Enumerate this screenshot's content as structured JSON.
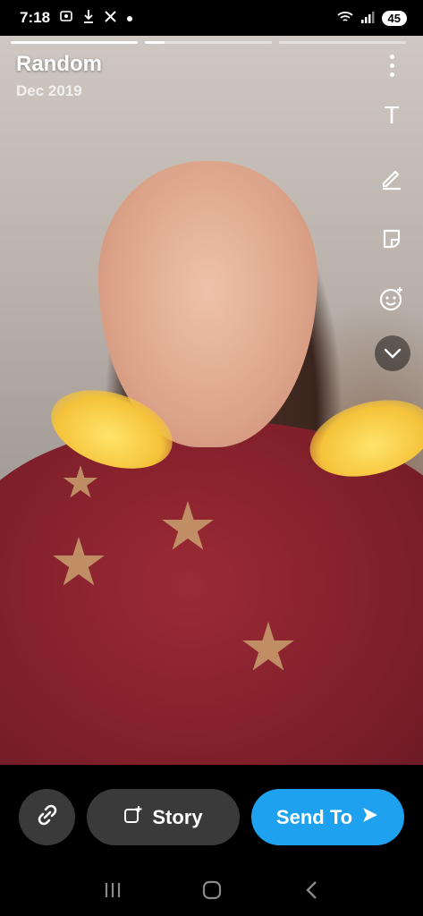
{
  "status_bar": {
    "time": "7:18",
    "battery": "45",
    "left_icons": [
      "screenshot-icon",
      "download-icon",
      "x-icon",
      "dot-icon"
    ],
    "right_icons": [
      "wifi-icon",
      "signal-icon"
    ]
  },
  "story": {
    "title": "Random",
    "date": "Dec 2019",
    "progress": {
      "segments": 3,
      "active_index": 0,
      "fill": 0.55
    }
  },
  "toolbar": {
    "items": [
      "more-icon",
      "text-icon",
      "pencil-icon",
      "sticker-icon",
      "emoji-icon",
      "chevron-down-icon"
    ],
    "text_glyph": "T"
  },
  "actions": {
    "link_icon": "link-icon",
    "story_label": "Story",
    "send_label": "Send To",
    "accent": "#1ea1ee"
  },
  "nav": {
    "items": [
      "recents-icon",
      "home-icon",
      "back-icon"
    ]
  }
}
